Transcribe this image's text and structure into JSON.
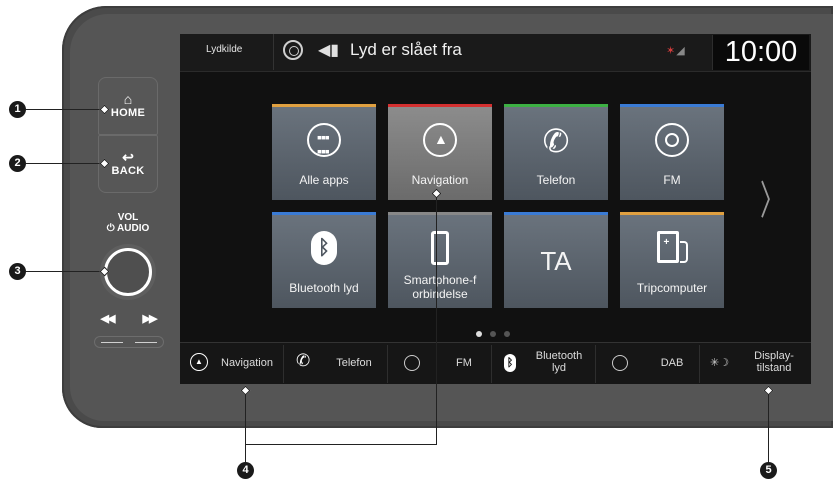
{
  "hardware": {
    "home_label": "HOME",
    "back_label": "BACK",
    "vol_label_line1": "VOL",
    "vol_label_line2": "⏻ AUDIO",
    "prev_label": "◀◀",
    "next_label": "▶▶"
  },
  "statusbar": {
    "source_label": "Lydkilde",
    "mute_text": "Lyd er slået fra",
    "clock": "10:00"
  },
  "tiles": [
    {
      "label": "Alle apps",
      "icon": "apps-grid-icon",
      "accent": "#e0a040"
    },
    {
      "label": "Navigation",
      "icon": "navigation-arrow-icon",
      "accent": "#d43030"
    },
    {
      "label": "Telefon",
      "icon": "phone-icon",
      "accent": "#3cb043"
    },
    {
      "label": "FM",
      "icon": "radio-icon",
      "accent": "#3a7bd5"
    },
    {
      "label": "Bluetooth lyd",
      "icon": "bluetooth-icon",
      "accent": "#3a7bd5"
    },
    {
      "label": "Smartphone-forbindelse",
      "label_line1": "Smartphone-f",
      "label_line2": "orbindelse",
      "icon": "smartphone-icon",
      "accent": "#888888"
    },
    {
      "label": "TA",
      "icon": "ta-text-icon",
      "accent": "#3a7bd5"
    },
    {
      "label": "Tripcomputer",
      "icon": "fuel-pump-icon",
      "accent": "#e0a040"
    }
  ],
  "shortcuts": [
    {
      "label": "Navigation",
      "icon": "navigation-arrow-icon"
    },
    {
      "label": "Telefon",
      "icon": "phone-icon"
    },
    {
      "label": "FM",
      "icon": "radio-icon"
    },
    {
      "label_line1": "Bluetooth",
      "label_line2": "lyd",
      "icon": "bluetooth-icon"
    },
    {
      "label": "DAB",
      "icon": "radio-icon"
    },
    {
      "label_line1": "Display-",
      "label_line2": "tilstand",
      "icon": "day-night-icon"
    }
  ],
  "pager": {
    "pages": 3,
    "current": 1
  },
  "callouts": [
    "1",
    "2",
    "3",
    "4",
    "5"
  ]
}
